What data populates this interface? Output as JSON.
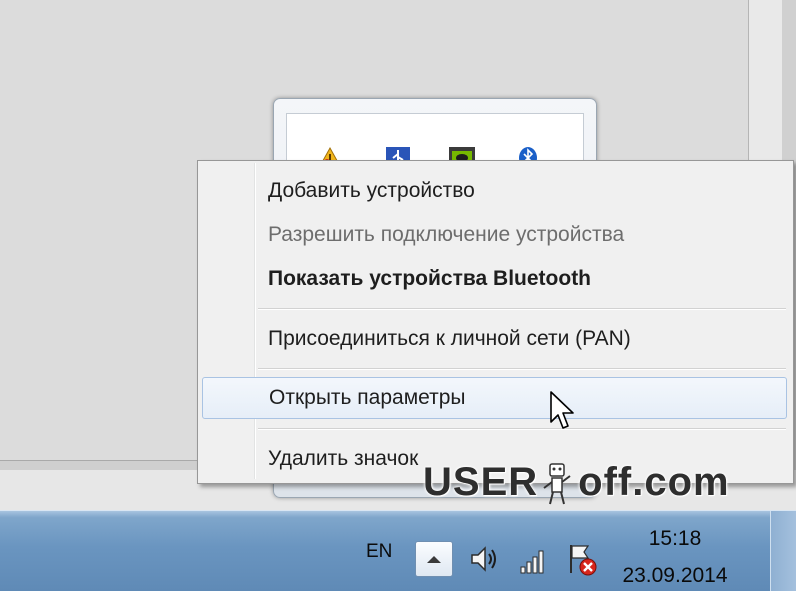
{
  "context_menu": {
    "items": [
      {
        "label": "Добавить устройство",
        "state": "normal"
      },
      {
        "label": "Разрешить подключение устройства",
        "state": "disabled"
      },
      {
        "label": "Показать устройства Bluetooth",
        "state": "default"
      },
      {
        "label": "Присоединиться к личной сети (PAN)",
        "state": "normal"
      },
      {
        "label": "Открыть параметры",
        "state": "hover"
      },
      {
        "label": "Удалить значок",
        "state": "normal"
      }
    ]
  },
  "tray_flyout": {
    "icons": [
      "warning-icon",
      "usb-icon",
      "nvidia-icon",
      "bluetooth-icon"
    ]
  },
  "taskbar": {
    "language": "EN",
    "clock": {
      "time": "15:18",
      "date": "23.09.2014"
    },
    "tray_icons": [
      "show-hidden-icons-button",
      "volume-icon",
      "network-icon",
      "action-center-icon"
    ]
  },
  "watermark": {
    "left": "USER",
    "right": "off.com"
  },
  "colors": {
    "taskbar": "#6a95c0",
    "menu_bg": "#f0f0f0",
    "menu_hover_border": "#a9c3e3",
    "disabled_text": "#6d6d6d"
  }
}
